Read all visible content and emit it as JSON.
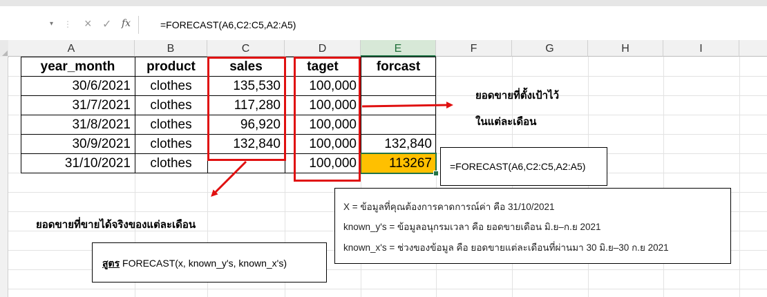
{
  "formula_bar": {
    "cancel_icon": "×",
    "enter_icon": "✓",
    "fx_label": "fx",
    "formula": "=FORECAST(A6,C2:C5,A2:A5)"
  },
  "columns": [
    "A",
    "B",
    "C",
    "D",
    "E",
    "F",
    "G",
    "H",
    "I"
  ],
  "selected_column": "E",
  "table": {
    "headers": [
      "year_month",
      "product",
      "sales",
      "taget",
      "forcast"
    ],
    "rows": [
      [
        "30/6/2021",
        "clothes",
        "135,530",
        "100,000",
        ""
      ],
      [
        "31/7/2021",
        "clothes",
        "117,280",
        "100,000",
        ""
      ],
      [
        "31/8/2021",
        "clothes",
        "96,920",
        "100,000",
        ""
      ],
      [
        "30/9/2021",
        "clothes",
        "132,840",
        "100,000",
        "132,840"
      ],
      [
        "31/10/2021",
        "clothes",
        "",
        "100,000",
        "113267"
      ]
    ]
  },
  "annotations": {
    "target_note_line1": "ยอดขายที่ตั้งเป้าไว้",
    "target_note_line2": "ในแต่ละเดือน",
    "actual_note": "ยอดขายที่ขายได้จริงของแต่ละเดือน",
    "formula_callout": "=FORECAST(A6,C2:C5,A2:A5)",
    "explain_x": "X = ข้อมูลที่คุณต้องการคาดการณ์ค่า คือ 31/10/2021",
    "explain_known_y": "known_y's = ข้อมูลอนุกรมเวลา คือ ยอดขายเดือน มิ.ย–ก.ย 2021",
    "explain_known_x": "known_x's = ช่วงของข้อมูล คือ ยอดขายแต่ละเดือนที่ผ่านมา 30 มิ.ย–30 ก.ย 2021",
    "syntax_label": "สูตร",
    "syntax_text": "FORECAST(x, known_y's, known_x's)"
  },
  "colors": {
    "highlight_red": "#e01010",
    "forecast_fill": "#ffc000",
    "excel_green": "#217346"
  }
}
